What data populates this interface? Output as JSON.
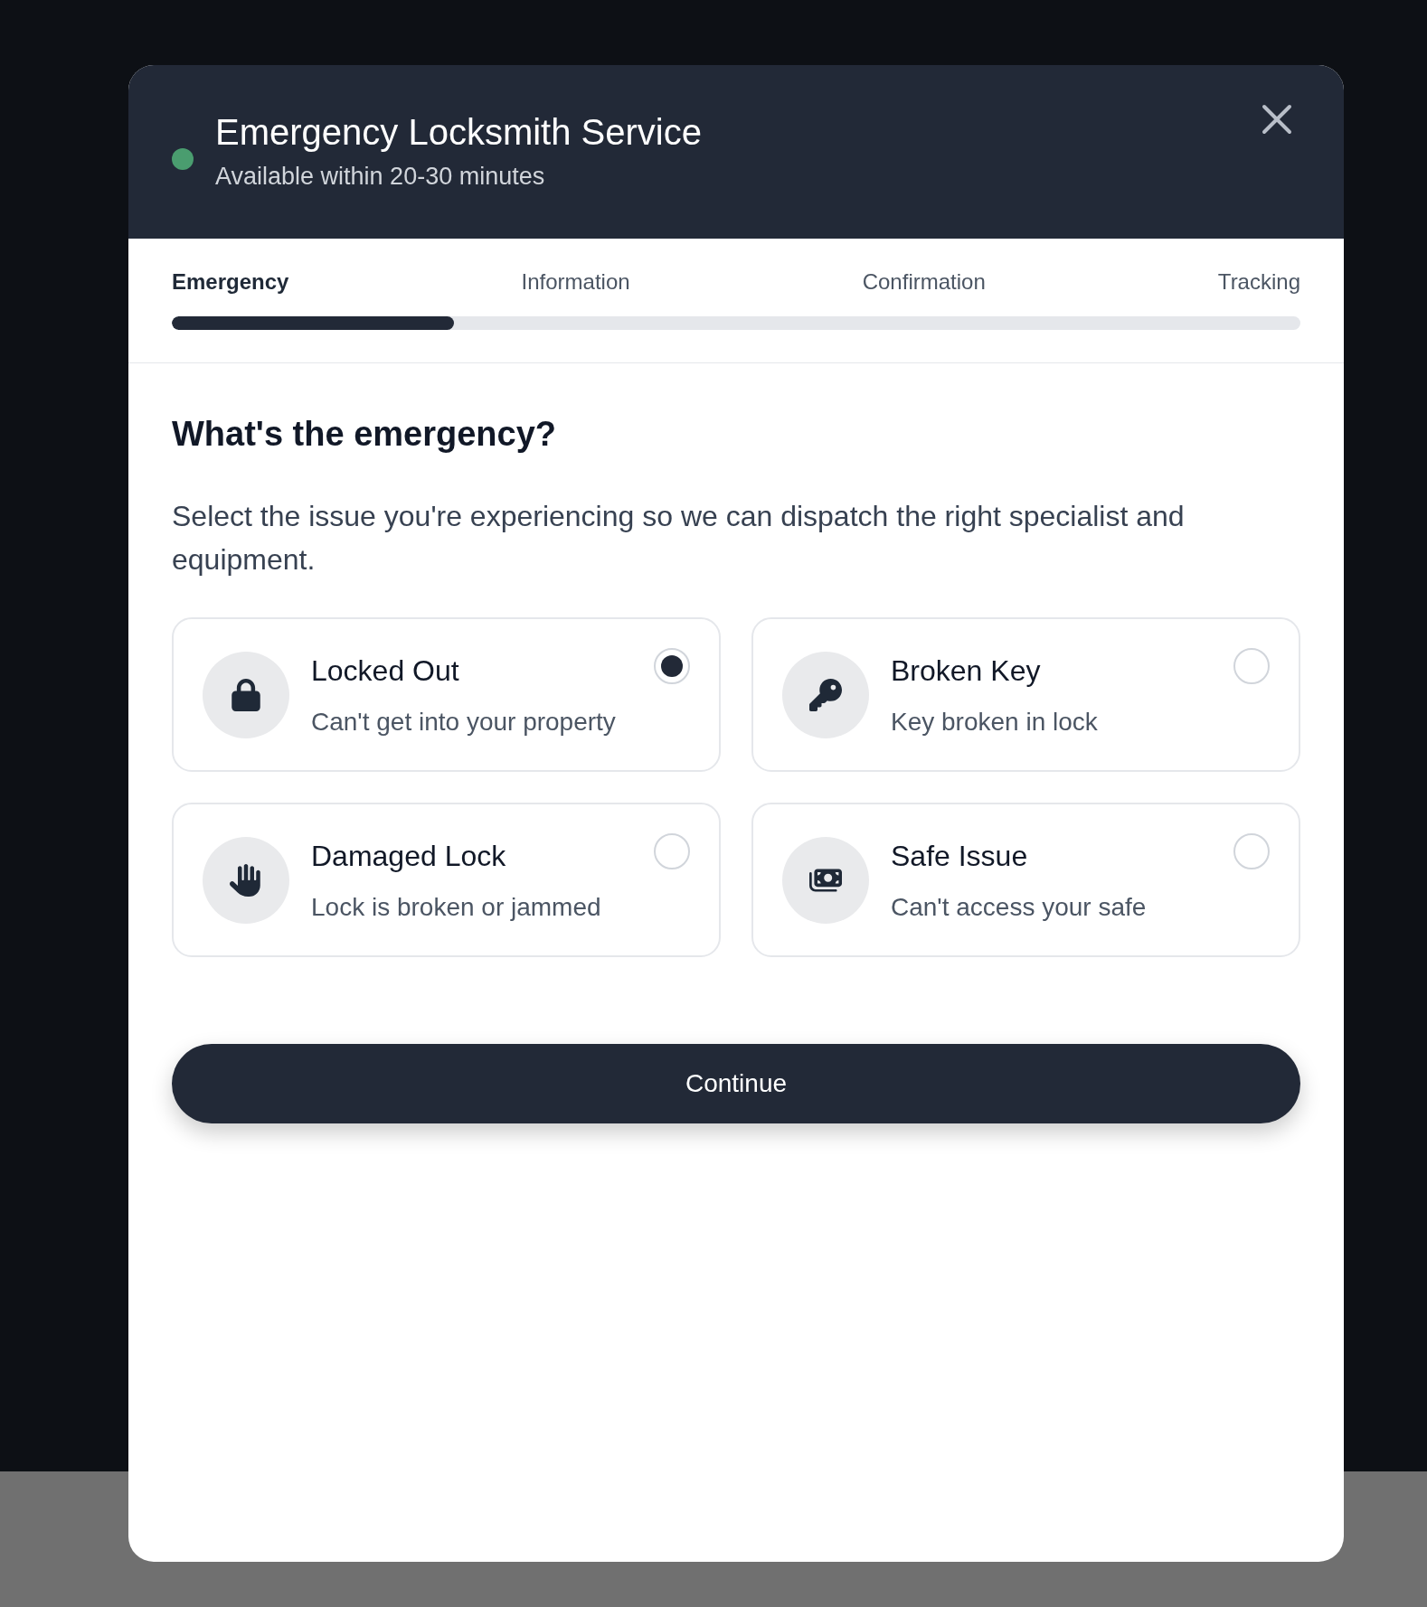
{
  "dialog": {
    "title": "Emergency Locksmith Service",
    "subtitle": "Available within 20-30 minutes"
  },
  "steps": [
    {
      "label": "Emergency",
      "selected": true
    },
    {
      "label": "Information",
      "selected": false
    },
    {
      "label": "Confirmation",
      "selected": false
    },
    {
      "label": "Tracking",
      "selected": false
    }
  ],
  "progress": {
    "level": 0.25
  },
  "heading": "What's the emergency?",
  "description": "Select the issue you're experiencing so we can dispatch the right specialist and equipment.",
  "options": [
    {
      "title": "Locked Out",
      "subtitle": "Can't get into your property",
      "selected": true
    },
    {
      "title": "Broken Key",
      "subtitle": "Key broken in lock",
      "selected": false
    },
    {
      "title": "Damaged Lock",
      "subtitle": "Lock is broken or jammed",
      "selected": false
    },
    {
      "title": "Safe Issue",
      "subtitle": "Can't access your safe",
      "selected": false
    }
  ],
  "continue_button": "Continue"
}
